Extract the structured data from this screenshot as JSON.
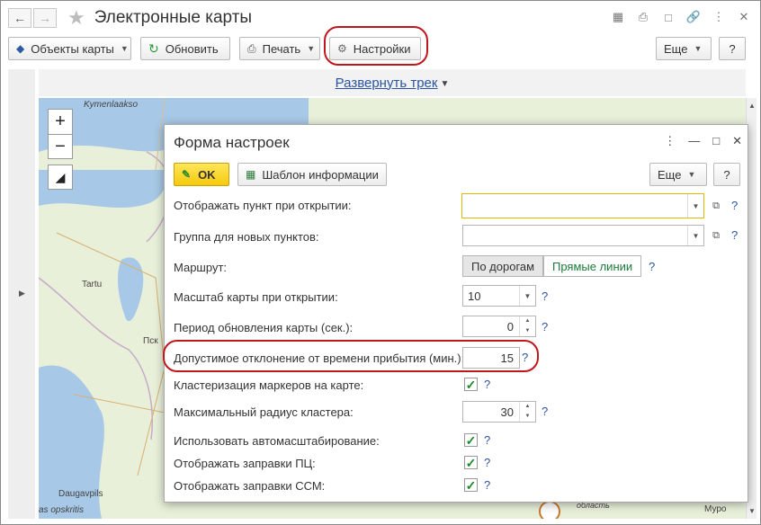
{
  "window": {
    "title": "Электронные карты"
  },
  "toolbar": {
    "objects": "Объекты карты",
    "refresh": "Обновить",
    "print": "Печать",
    "settings": "Настройки",
    "more": "Еще",
    "help": "?"
  },
  "track": {
    "link": "Развернуть трек"
  },
  "map": {
    "labels": {
      "kymenlaakso": "Kymenlaakso",
      "tartu": "Tartu",
      "pskov": "Пск",
      "daugavpils": "Daugavpils",
      "opskritis": "as opskritis",
      "murom": "Муро",
      "oblast": "область"
    },
    "zoom_in": "+",
    "zoom_out": "−"
  },
  "dialog": {
    "title": "Форма настроек",
    "ok": "OK",
    "template": "Шаблон информации",
    "more": "Еще",
    "help": "?",
    "fields": {
      "show_point": "Отображать пункт при открытии:",
      "group": "Группа для новых пунктов:",
      "route": "Маршрут:",
      "route_opt1": "По дорогам",
      "route_opt2": "Прямые линии",
      "scale": "Масштаб карты при открытии:",
      "scale_value": "10",
      "period": "Период обновления карты (сек.):",
      "period_value": "0",
      "deviation": "Допустимое отклонение от времени прибытия (мин.):",
      "deviation_value": "15",
      "cluster": "Кластеризация маркеров на карте:",
      "radius": "Максимальный радиус кластера:",
      "radius_value": "30",
      "autoscale": "Использовать автомасштабирование:",
      "fuel_pc": "Отображать заправки ПЦ:",
      "fuel_ssm": "Отображать заправки ССМ:"
    },
    "qmark": "?"
  },
  "colors": {
    "accent": "#2954a3",
    "ok_button": "#f5c90c",
    "highlight": "#c0161c",
    "check": "#1a8a2a"
  }
}
